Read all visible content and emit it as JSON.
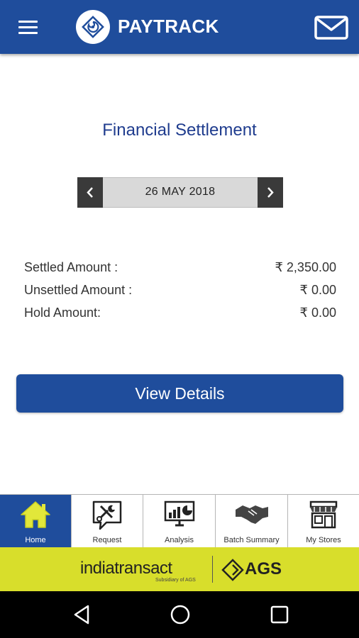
{
  "app": {
    "title": "PAYTRACK"
  },
  "page": {
    "title": "Financial Settlement"
  },
  "date_selector": {
    "date": "26 MAY 2018"
  },
  "amounts": [
    {
      "label": "Settled Amount :",
      "value": "₹ 2,350.00"
    },
    {
      "label": "Unsettled Amount :",
      "value": "₹ 0.00"
    },
    {
      "label": "Hold Amount:",
      "value": "₹ 0.00"
    }
  ],
  "actions": {
    "view_details": "View Details"
  },
  "bottom_nav": [
    {
      "label": "Home",
      "icon": "home-icon",
      "active": true
    },
    {
      "label": "Request",
      "icon": "tools-icon",
      "active": false
    },
    {
      "label": "Analysis",
      "icon": "analysis-icon",
      "active": false
    },
    {
      "label": "Batch Summary",
      "icon": "handshake-icon",
      "active": false
    },
    {
      "label": "My Stores",
      "icon": "store-icon",
      "active": false
    }
  ],
  "brand": {
    "name": "indiatransact",
    "subtitle": "Subsidiary of AGS",
    "partner": "AGS"
  },
  "colors": {
    "primary": "#1f4d9c",
    "active_icon": "#e2e73a",
    "brand_bar": "#d8de2b",
    "title_text": "#1f3c8e"
  }
}
